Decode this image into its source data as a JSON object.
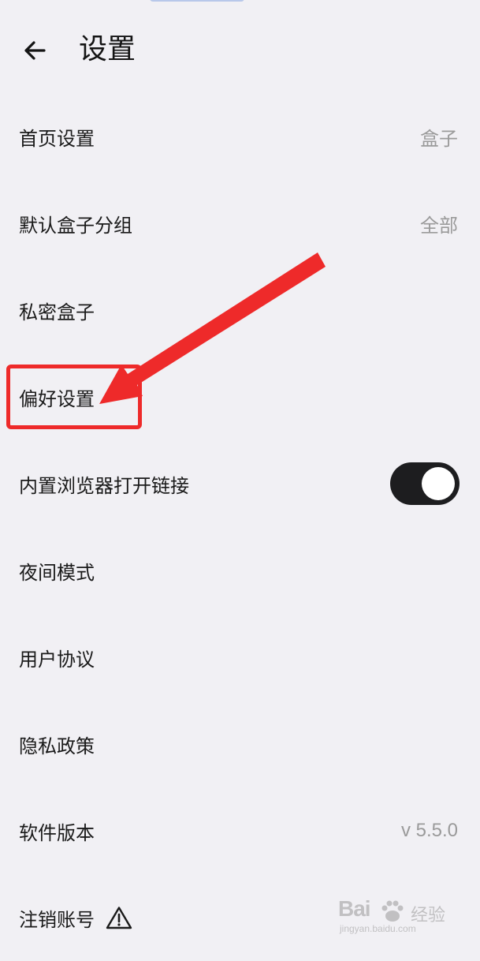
{
  "header": {
    "title": "设置",
    "back_icon": "arrow-left-icon"
  },
  "settings": {
    "home": {
      "label": "首页设置",
      "value": "盒子"
    },
    "default_group": {
      "label": "默认盒子分组",
      "value": "全部"
    },
    "private_box": {
      "label": "私密盒子"
    },
    "preferences": {
      "label": "偏好设置"
    },
    "builtin_browser": {
      "label": "内置浏览器打开链接",
      "toggle_on": true
    },
    "night_mode": {
      "label": "夜间模式"
    },
    "user_agreement": {
      "label": "用户协议"
    },
    "privacy_policy": {
      "label": "隐私政策"
    },
    "version": {
      "label": "软件版本",
      "value": "v 5.5.0"
    },
    "delete_account": {
      "label": "注销账号",
      "icon": "warning-icon"
    }
  },
  "annotation": {
    "color": "#ee2a2a",
    "highlighted_item": "偏好设置"
  },
  "watermark": {
    "logo": "Bai",
    "suffix": "经验",
    "url": "jingyan.baidu.com"
  },
  "colors": {
    "background": "#f1f0f4",
    "text": "#1a1a1a",
    "secondary_text": "#9a9a9a",
    "toggle_on": "#1d1d1f"
  }
}
